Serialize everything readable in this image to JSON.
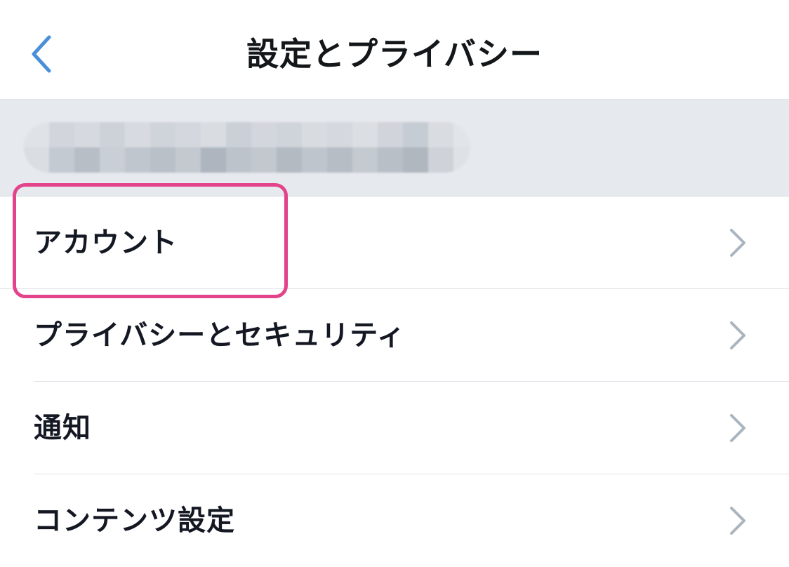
{
  "header": {
    "title": "設定とプライバシー",
    "back_icon": "chevron-left-icon",
    "accent_color": "#4a90d9"
  },
  "account": {
    "name_obscured": true
  },
  "settings": {
    "items": [
      {
        "label": "アカウント",
        "icon": "chevron-right-icon",
        "highlighted": true
      },
      {
        "label": "プライバシーとセキュリティ",
        "icon": "chevron-right-icon",
        "highlighted": false
      },
      {
        "label": "通知",
        "icon": "chevron-right-icon",
        "highlighted": false
      },
      {
        "label": "コンテンツ設定",
        "icon": "chevron-right-icon",
        "highlighted": false
      }
    ]
  },
  "colors": {
    "highlight": "#e3438a",
    "chevron": "#aab5bf",
    "section_bg": "#e6e9ee",
    "text": "#141823"
  }
}
